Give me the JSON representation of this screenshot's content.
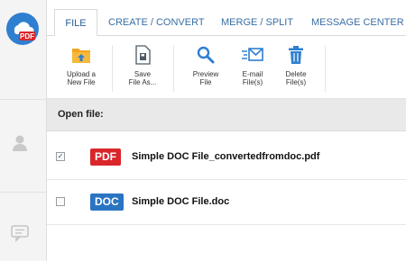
{
  "app": {
    "logo_text": "PDF",
    "brand_color": "#2f7fd1",
    "logo_badge_color": "#d9262b"
  },
  "tabs": [
    {
      "label": "FILE",
      "active": true
    },
    {
      "label": "CREATE / CONVERT",
      "active": false
    },
    {
      "label": "MERGE / SPLIT",
      "active": false
    },
    {
      "label": "MESSAGE CENTER",
      "active": false
    }
  ],
  "toolbar": {
    "upload": {
      "label": "Upload a\nNew File",
      "icon": "folder-upload-icon"
    },
    "save": {
      "label": "Save\nFile As...",
      "icon": "save-file-icon"
    },
    "preview": {
      "label": "Preview\nFile",
      "icon": "magnifier-icon"
    },
    "email": {
      "label": "E-mail\nFile(s)",
      "icon": "email-icon"
    },
    "delete": {
      "label": "Delete\nFile(s)",
      "icon": "trash-icon"
    }
  },
  "sidebar": {
    "items": [
      {
        "icon": "user-icon"
      },
      {
        "icon": "chat-icon"
      }
    ]
  },
  "open_file": {
    "label": "Open file:"
  },
  "files": [
    {
      "type": "PDF",
      "name": "Simple DOC File_convertedfromdoc.pdf",
      "checked": true,
      "badge_color": "#d9262b"
    },
    {
      "type": "DOC",
      "name": "Simple DOC File.doc",
      "checked": false,
      "badge_color": "#2a74c2"
    }
  ]
}
